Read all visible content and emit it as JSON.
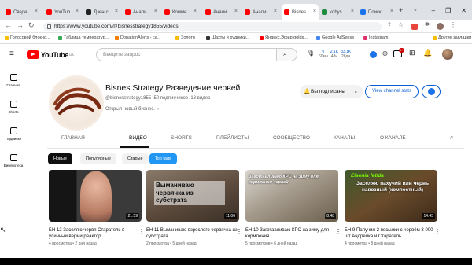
{
  "tabs": [
    {
      "label": "Сведе",
      "color": "#ff0000"
    },
    {
      "label": "YouTub",
      "color": "#ff0000"
    },
    {
      "label": "Дзен·с",
      "color": "#222222"
    },
    {
      "label": "Анали",
      "color": "#ff0000"
    },
    {
      "label": "Комме",
      "color": "#ff0000"
    },
    {
      "label": "Анали",
      "color": "#ff0000"
    },
    {
      "label": "Анали",
      "color": "#ff0000"
    },
    {
      "label": "Bisnes",
      "color": "#ff0000",
      "active": true
    },
    {
      "label": "kobys",
      "color": "#1e8e3e"
    },
    {
      "label": "Поиск",
      "color": "#1a73e8"
    }
  ],
  "address": {
    "url": "https://www.youtube.com/@bisnesstrategy1855/videos"
  },
  "bookmarks": [
    {
      "label": "Голосовой блокно...",
      "color": "#fbbc04"
    },
    {
      "label": "Таблица температур...",
      "color": "#34a853"
    },
    {
      "label": "DonationAlerts - ca...",
      "color": "#f57c00"
    },
    {
      "label": "Золото",
      "color": "#fbbc04"
    },
    {
      "label": "Шахты и рудники...",
      "color": "#333333"
    },
    {
      "label": "Яндекс.Эфир golds...",
      "color": "#ff0000"
    },
    {
      "label": "Google AdSense",
      "color": "#4285f4"
    },
    {
      "label": "Instagram",
      "color": "#e1306c"
    },
    {
      "label": "Другие закладки",
      "color": "#fbbc04"
    }
  ],
  "youtube": {
    "logo": "YouTube",
    "region": "UA",
    "search_placeholder": "Введите запрос",
    "stats": [
      {
        "v": "0",
        "l": "60мн"
      },
      {
        "v": "2.1K",
        "l": "48ч"
      },
      {
        "v": "33.1K",
        "l": "28дн"
      }
    ]
  },
  "sidebar": [
    {
      "label": "Главная",
      "icon": "home-icon"
    },
    {
      "label": "Shorts",
      "icon": "shorts-icon"
    },
    {
      "label": "Подписки",
      "icon": "subscriptions-icon"
    },
    {
      "label": "Библиотека",
      "icon": "library-icon"
    }
  ],
  "channel": {
    "title": "Bisnes Strategy Разведение червей",
    "handle": "@bisnesstrategy1855",
    "subscribers": "50 подписчиков",
    "videos": "13 видео",
    "description": "Открыл новый бизнес.",
    "subscribe_label": "Вы подписаны",
    "stats_label": "View channel stats"
  },
  "channel_tabs": [
    "ГЛАВНАЯ",
    "ВИДЕО",
    "SHORTS",
    "ПЛЕЙЛИСТЫ",
    "СООБЩЕСТВО",
    "КАНАЛЫ",
    "О КАНАЛЕ"
  ],
  "filters": [
    "Новые",
    "Популярные",
    "Старые",
    "Top tags"
  ],
  "videos": [
    {
      "title": "БН 12 Заселяю червя Старатель в уличный верми реактор...",
      "meta": "4 просмотра • 2 дня назад",
      "duration": "21:59",
      "thumb_text": ""
    },
    {
      "title": "БН 11 Выманиваю взрослого червячка из субстрата...",
      "meta": "2 просмотра • 5 дней назад",
      "duration": "11:06",
      "thumb_text": "Выманиваю червячка из субстрата"
    },
    {
      "title": "БН 10 Заготавливаю КРС на зиму для кормления...",
      "meta": "5 просмотров • 6 дней назад",
      "duration": "8:48",
      "thumb_text": "Заготавливаю КРС на зиму для кормления червей"
    },
    {
      "title": "БН 9 Получил 2 посылки с червём 3 000 шт Андрейка и Старатель...",
      "meta": "4 просмотра • 8 дней назад",
      "duration": "14:45",
      "thumb_green": "Eisenia fetida",
      "thumb_text": "Заселяю пахучий или червь навозный (компостный)"
    }
  ]
}
